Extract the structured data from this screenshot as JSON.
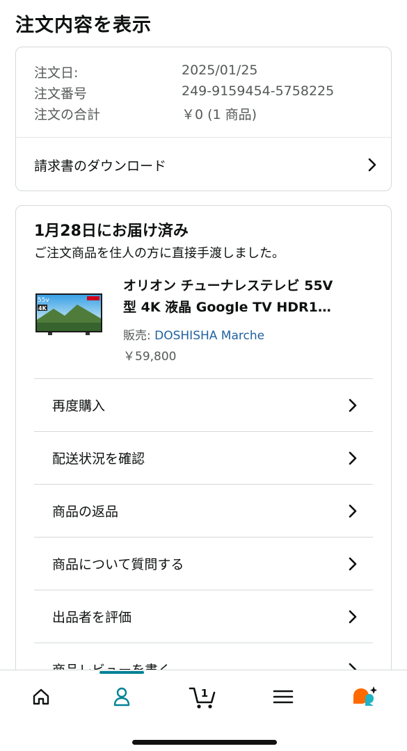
{
  "page": {
    "title": "注文内容を表示"
  },
  "summary": {
    "order_date_label": "注文日:",
    "order_date": "2025/01/25",
    "order_number_label": "注文番号",
    "order_number": "249-9159454-5758225",
    "total_label": "注文の合計",
    "total": "￥0 (1 商品)",
    "invoice_label": "請求書のダウンロード"
  },
  "delivery": {
    "status": "1月28日にお届け済み",
    "note": "ご注文商品を住人の方に直接手渡しました。",
    "product": {
      "title_line1": "オリオン チューナレステレビ 55V",
      "title_line2": "型 4K 液晶 Google TV HDR1…",
      "seller_label": "販売:",
      "seller_name": "DOSHISHA Marche",
      "price": "￥59,800",
      "thumb_badge_size": "55v",
      "thumb_badge_4k": "4K"
    },
    "actions": [
      {
        "label": "再度購入"
      },
      {
        "label": "配送状況を確認"
      },
      {
        "label": "商品の返品"
      },
      {
        "label": "商品について質問する"
      },
      {
        "label": "出品者を評価"
      },
      {
        "label": "商品レビューを書く"
      }
    ]
  },
  "bottom_nav": {
    "items": [
      {
        "icon": "home-icon"
      },
      {
        "icon": "account-icon",
        "active": true
      },
      {
        "icon": "cart-icon",
        "badge": "1"
      },
      {
        "icon": "menu-icon"
      },
      {
        "icon": "rufus-ai-icon"
      }
    ],
    "active_color": "#008296",
    "ai_color": "#ff6a00"
  }
}
